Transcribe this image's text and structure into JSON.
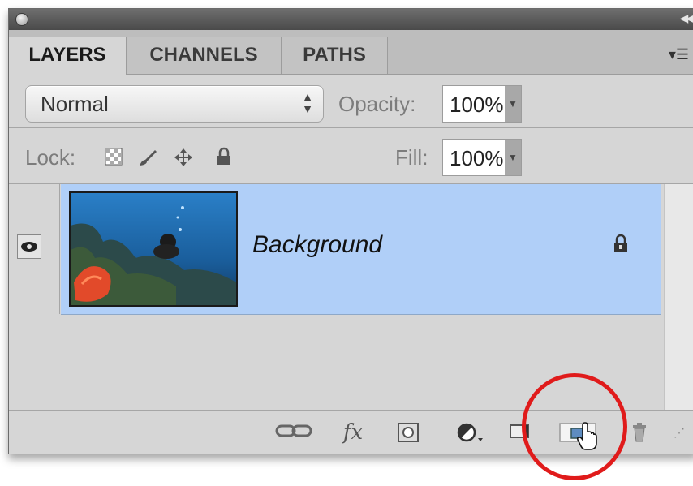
{
  "panel": {
    "tabs": [
      {
        "label": "LAYERS",
        "active": true
      },
      {
        "label": "CHANNELS",
        "active": false
      },
      {
        "label": "PATHS",
        "active": false
      }
    ],
    "blend_mode": "Normal",
    "opacity_label": "Opacity:",
    "opacity_value": "100%",
    "lock_label": "Lock:",
    "fill_label": "Fill:",
    "fill_value": "100%"
  },
  "layers": [
    {
      "name": "Background",
      "visible": true,
      "locked": true,
      "selected": true
    }
  ],
  "colors": {
    "selection": "#b0cff8",
    "highlight_circle": "#e01b1b"
  },
  "bottom_icons": [
    "link-layers-icon",
    "fx-icon",
    "add-mask-icon",
    "adjustment-layer-icon",
    "new-group-icon",
    "new-layer-icon",
    "trash-icon"
  ]
}
